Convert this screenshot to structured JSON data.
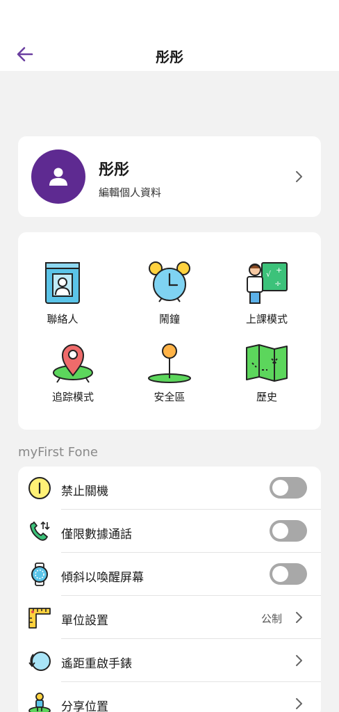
{
  "header": {
    "title": "彤彤"
  },
  "profile": {
    "name": "彤彤",
    "subtitle": "編輯個人資料"
  },
  "features": [
    {
      "label": "聯絡人",
      "icon": "contacts-book-icon"
    },
    {
      "label": "鬧鐘",
      "icon": "alarm-clock-icon"
    },
    {
      "label": "上課模式",
      "icon": "class-mode-icon"
    },
    {
      "label": "追踪模式",
      "icon": "tracking-pin-icon"
    },
    {
      "label": "安全區",
      "icon": "safe-zone-pin-icon"
    },
    {
      "label": "歷史",
      "icon": "history-map-icon"
    }
  ],
  "section_title": "myFirst Fone",
  "settings": [
    {
      "label": "禁止關機",
      "type": "toggle",
      "on": false,
      "icon": "power-icon"
    },
    {
      "label": "僅限數據通話",
      "type": "toggle",
      "on": false,
      "icon": "phone-data-icon"
    },
    {
      "label": "傾斜以喚醒屏幕",
      "type": "toggle",
      "on": false,
      "icon": "watch-icon"
    },
    {
      "label": "單位設置",
      "type": "link",
      "value": "公制",
      "icon": "ruler-icon"
    },
    {
      "label": "遙距重啟手錶",
      "type": "link",
      "icon": "remote-restart-icon"
    },
    {
      "label": "分享位置",
      "type": "link",
      "icon": "share-location-icon"
    }
  ],
  "colors": {
    "accent": "#5e2a91",
    "background": "#f2f2f2",
    "toggle_off": "#a8a8a8"
  }
}
